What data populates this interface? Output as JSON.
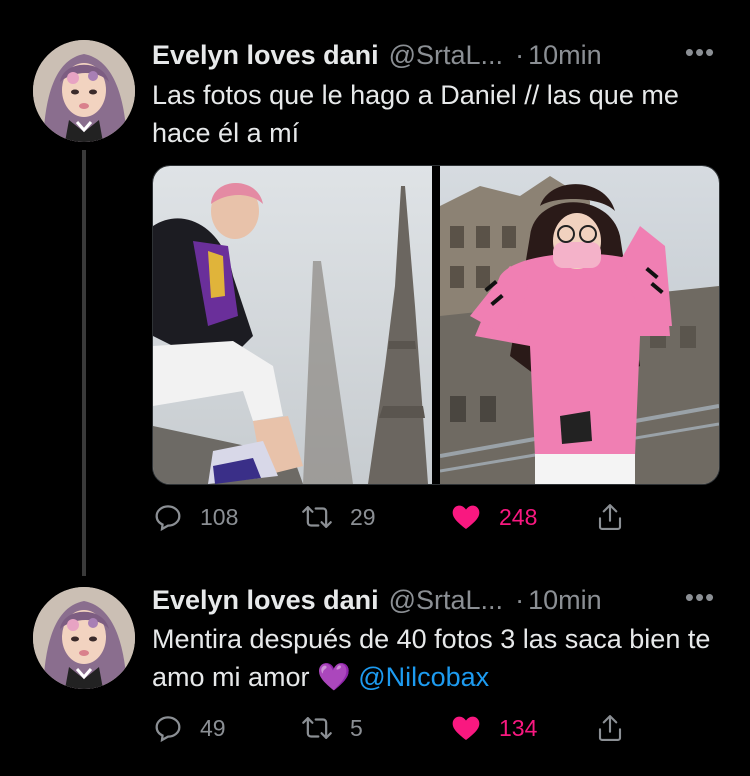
{
  "tweets": [
    {
      "name": "Evelyn loves dani",
      "handle": "@SrtaL...",
      "dot": "·",
      "time": "10min",
      "more": "•••",
      "text": "Las fotos que le hago a Daniel // las que me hace él a mí",
      "replies": "108",
      "retweets": "29",
      "likes": "248"
    },
    {
      "name": "Evelyn loves dani",
      "handle": "@SrtaL...",
      "dot": "·",
      "time": "10min",
      "more": "•••",
      "text_before": "Mentira después de 40 fotos 3 las saca bien te amo mi amor ",
      "emoji": "💜",
      "mention": "@Nilcobax",
      "replies": "49",
      "retweets": "5",
      "likes": "134"
    }
  ],
  "colors": {
    "like": "#f91880",
    "mention": "#1d9bf0",
    "muted": "#8b8f94"
  }
}
